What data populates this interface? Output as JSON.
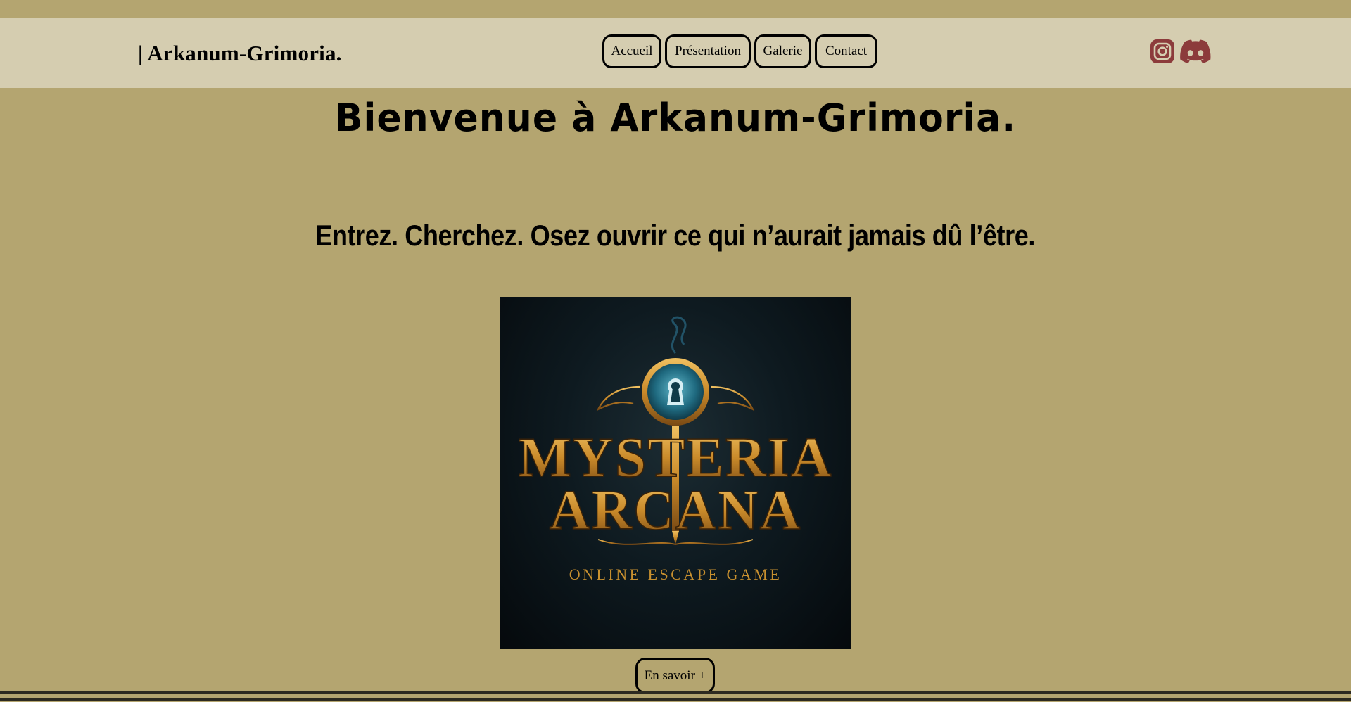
{
  "header": {
    "logo_text": "| Arkanum-Grimoria.",
    "nav": [
      {
        "label": "Accueil"
      },
      {
        "label": "Présentation"
      },
      {
        "label": "Galerie"
      },
      {
        "label": "Contact"
      }
    ],
    "socials": [
      {
        "icon": "instagram-icon"
      },
      {
        "icon": "discord-icon"
      }
    ]
  },
  "main": {
    "welcome_title": "Bienvenue à Arkanum-Grimoria.",
    "tagline": "Entrez. Cherchez. Osez ouvrir ce qui n’aurait jamais dû l’être.",
    "poster": {
      "title_line1": "MYSTERIA",
      "title_line2": "ARCANA",
      "subtitle": "ONLINE ESCAPE GAME"
    },
    "more_button": "En savoir +"
  },
  "colors": {
    "page_background": "#b4a570",
    "header_background": "#d5cdb0",
    "social_icon_color": "#8c3b3b",
    "poster_gold": "#c8902f"
  }
}
